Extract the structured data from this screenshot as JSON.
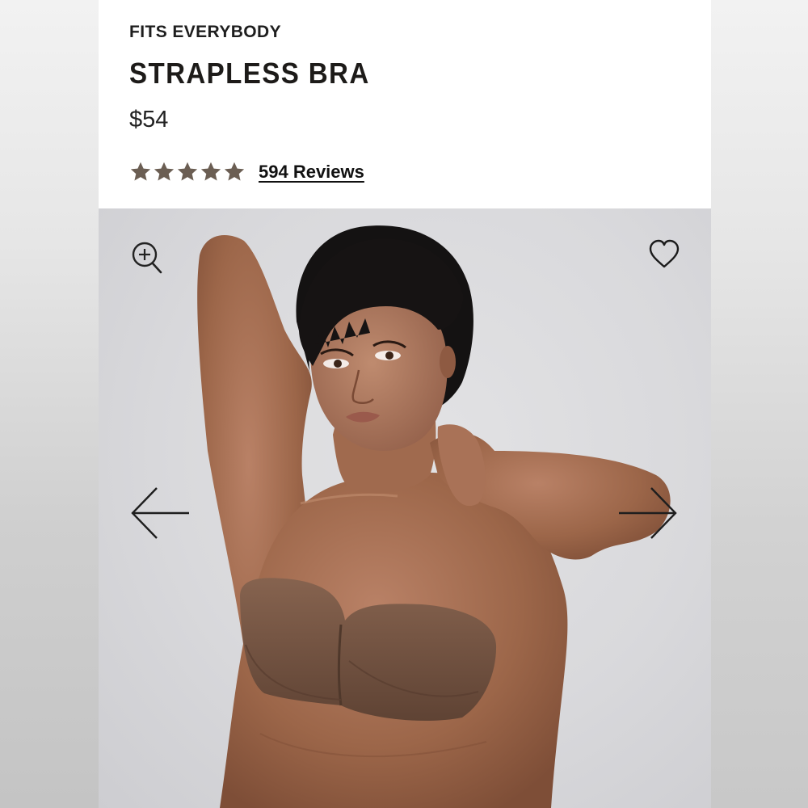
{
  "product": {
    "brand": "FITS EVERYBODY",
    "name": "STRAPLESS BRA",
    "price": "$54",
    "rating": 5,
    "reviews_label": "594 Reviews"
  },
  "colors": {
    "star": "#6b5e53",
    "skin": "#a46e52",
    "bra": "#7a5a48",
    "hair": "#141212",
    "background": "#dcdcdf"
  },
  "icons": {
    "zoom": "zoom-in-icon",
    "favorite": "heart-icon",
    "previous": "arrow-left-icon",
    "next": "arrow-right-icon"
  }
}
